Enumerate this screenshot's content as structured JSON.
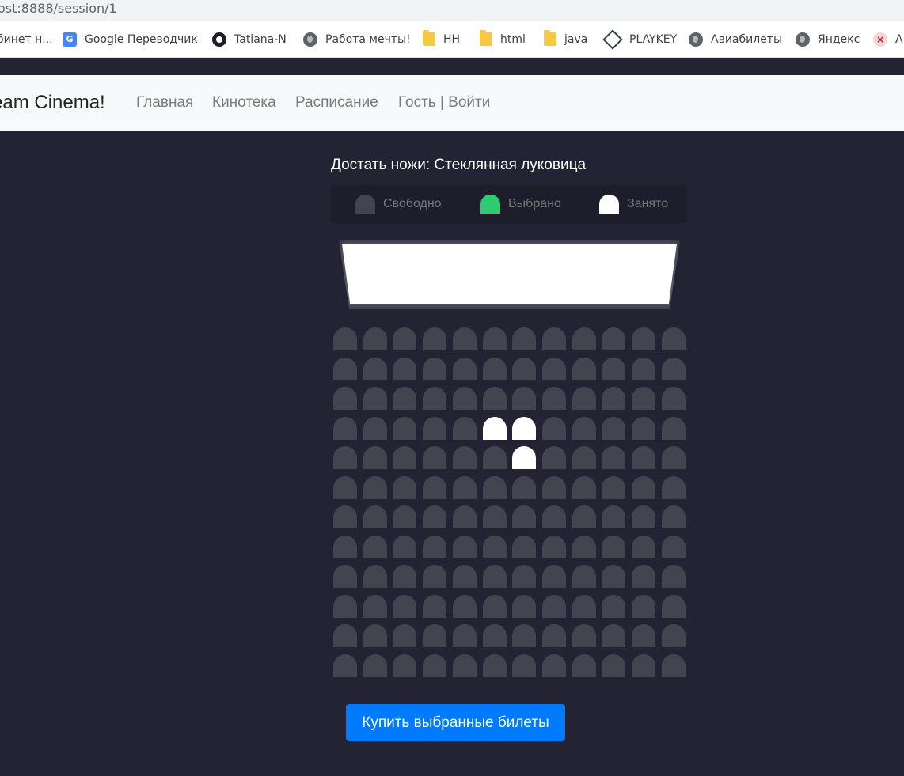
{
  "browser": {
    "url": "ost:8888/session/1",
    "bookmarks": [
      {
        "label": "бинет н...",
        "icon": "globe-icon"
      },
      {
        "label": "Google Переводчик",
        "icon": "google-translate-icon"
      },
      {
        "label": "Tatiana-N",
        "icon": "github-icon"
      },
      {
        "label": "Работа мечты!",
        "icon": "globe-icon"
      },
      {
        "label": "HH",
        "icon": "folder-icon"
      },
      {
        "label": "html",
        "icon": "folder-icon"
      },
      {
        "label": "java",
        "icon": "folder-icon"
      },
      {
        "label": "PLAYKEY",
        "icon": "playkey-icon"
      },
      {
        "label": "Авиабилеты",
        "icon": "globe-icon"
      },
      {
        "label": "Яндекс",
        "icon": "globe-icon"
      },
      {
        "label": "А",
        "icon": "blocked-icon"
      }
    ]
  },
  "navbar": {
    "brand": "eam Cinema!",
    "links": [
      "Главная",
      "Кинотека",
      "Расписание",
      "Гость | Войти"
    ]
  },
  "session": {
    "movie_title": "Достать ножи: Стеклянная луковица",
    "legend": {
      "free": "Свободно",
      "selected": "Выбрано",
      "occupied": "Занято"
    },
    "hall": {
      "rows": 12,
      "seats_per_row": 12,
      "occupied": [
        [
          4,
          6
        ],
        [
          4,
          7
        ],
        [
          5,
          7
        ]
      ],
      "selected": []
    },
    "buy_button": "Купить выбранные билеты"
  },
  "colors": {
    "background": "#242333",
    "seat_free": "#444451",
    "seat_selected": "#2ecc71",
    "seat_occupied": "#ffffff",
    "button": "#007bff"
  }
}
